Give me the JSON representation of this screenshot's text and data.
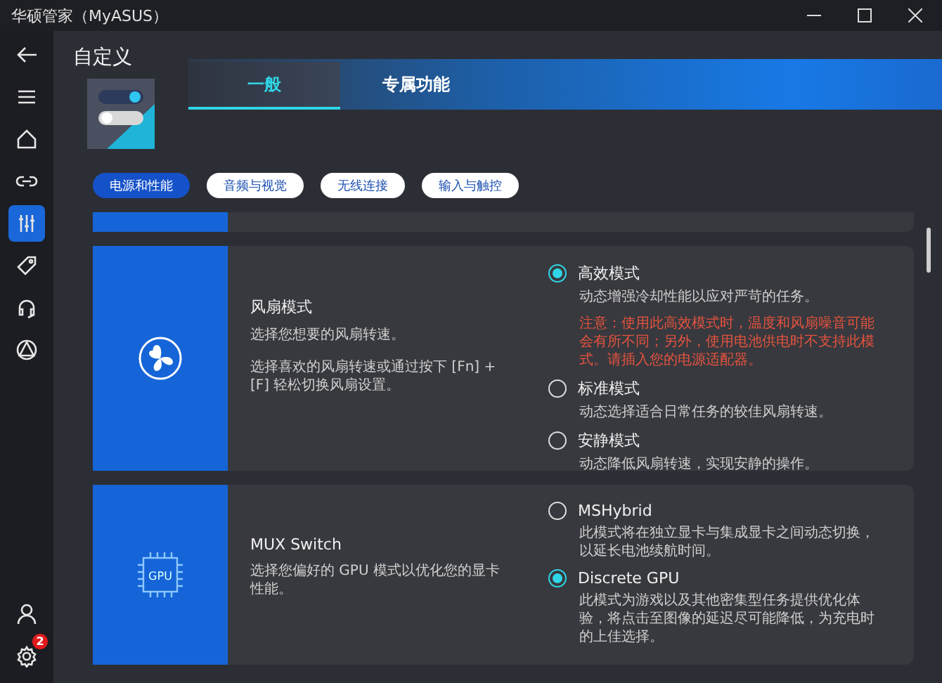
{
  "window": {
    "title": "华硕管家（MyASUS）"
  },
  "sidebar": {
    "items": [
      {
        "kind": "back",
        "selected": false
      },
      {
        "kind": "menu",
        "selected": false
      },
      {
        "kind": "home",
        "selected": false
      },
      {
        "kind": "link",
        "selected": false
      },
      {
        "kind": "sliders",
        "selected": true
      },
      {
        "kind": "tag",
        "selected": false
      },
      {
        "kind": "headset",
        "selected": false
      },
      {
        "kind": "triangle",
        "selected": false
      }
    ],
    "bottom_items": [
      {
        "kind": "user",
        "selected": false
      },
      {
        "kind": "settings",
        "selected": false,
        "badge": "2"
      }
    ]
  },
  "page_title": "自定义",
  "tabs": [
    {
      "label": "一般",
      "selected": true
    },
    {
      "label": "专属功能",
      "selected": false
    }
  ],
  "chips": [
    {
      "label": "电源和性能",
      "selected": true
    },
    {
      "label": "音频与视觉",
      "selected": false
    },
    {
      "label": "无线连接",
      "selected": false
    },
    {
      "label": "输入与触控",
      "selected": false
    }
  ],
  "cards": [
    {
      "kind": "fan",
      "title": "风扇模式",
      "descriptions": [
        "选择您想要的风扇转速。",
        "选择喜欢的风扇转速或通过按下 [Fn] + [F] 轻松切换风扇设置。"
      ],
      "options": [
        {
          "label": "高效模式",
          "selected": true,
          "description": "动态增强冷却性能以应对严苛的任务。",
          "warning": "注意：使用此高效模式时，温度和风扇噪音可能会有所不同；另外，使用电池供电时不支持此模式。请插入您的电源适配器。"
        },
        {
          "label": "标准模式",
          "selected": false,
          "description": "动态选择适合日常任务的较佳风扇转速。"
        },
        {
          "label": "安静模式",
          "selected": false,
          "description": "动态降低风扇转速，实现安静的操作。"
        }
      ]
    },
    {
      "kind": "gpu",
      "icon_text": "GPU",
      "title": "MUX Switch",
      "descriptions": [
        "选择您偏好的 GPU 模式以优化您的显卡性能。"
      ],
      "options": [
        {
          "label": "MSHybrid",
          "selected": false,
          "description": "此模式将在独立显卡与集成显卡之间动态切换，以延长电池续航时间。"
        },
        {
          "label": "Discrete GPU",
          "selected": true,
          "description": "此模式为游戏以及其他密集型任务提供优化体验，将点击至图像的延迟尽可能降低，为充电时的上佳选择。"
        }
      ]
    }
  ]
}
